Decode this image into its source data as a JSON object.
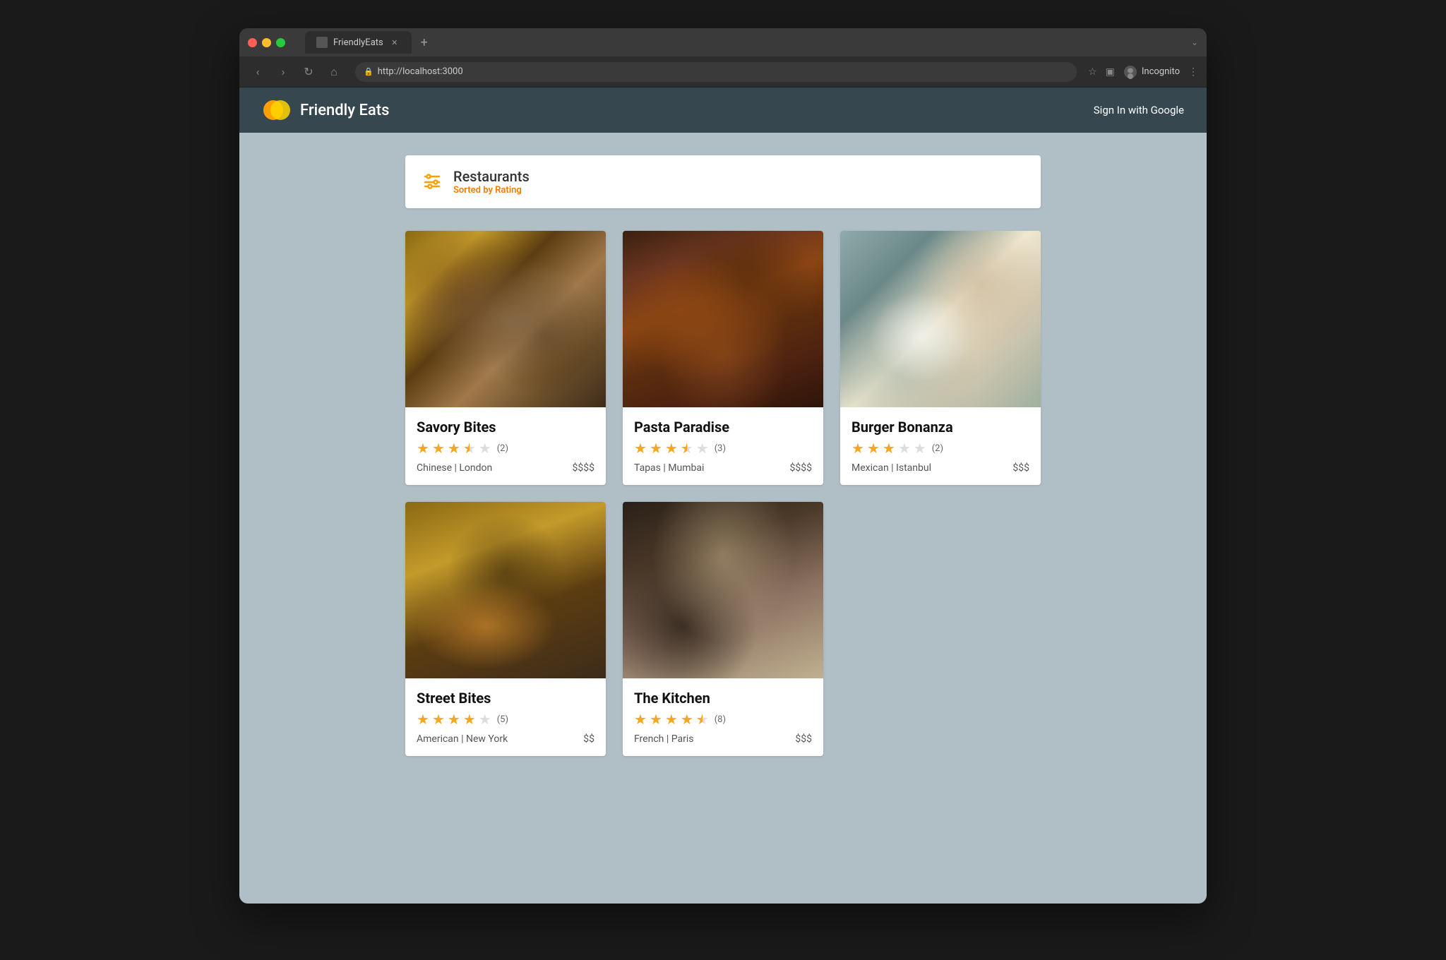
{
  "browser": {
    "traffic_lights": [
      "red",
      "yellow",
      "green"
    ],
    "tab_title": "FriendlyEats",
    "new_tab_label": "+",
    "address": "http://localhost:3000",
    "nav": {
      "back": "‹",
      "forward": "›",
      "reload": "↻",
      "home": "⌂"
    },
    "right_controls": {
      "star": "☆",
      "square": "▣",
      "incognito_label": "Incognito",
      "menu": "⋮",
      "dropdown": "⌄"
    }
  },
  "app": {
    "name": "Friendly Eats",
    "sign_in_label": "Sign In with Google",
    "header": {
      "title": "Restaurants",
      "subtitle": "Sorted by Rating"
    },
    "restaurants": [
      {
        "id": 1,
        "name": "Savory Bites",
        "stars": 3.5,
        "review_count": 2,
        "cuisine": "Chinese",
        "location": "London",
        "price": "$$$$",
        "image_type": "pasta"
      },
      {
        "id": 2,
        "name": "Pasta Paradise",
        "stars": 3.5,
        "review_count": 3,
        "cuisine": "Tapas",
        "location": "Mumbai",
        "price": "$$$$",
        "image_type": "meat"
      },
      {
        "id": 3,
        "name": "Burger Bonanza",
        "stars": 3,
        "review_count": 2,
        "cuisine": "Mexican",
        "location": "Istanbul",
        "price": "$$$",
        "image_type": "tableview"
      },
      {
        "id": 4,
        "name": "Street Bites",
        "stars": 4,
        "review_count": 5,
        "cuisine": "American",
        "location": "New York",
        "price": "$$",
        "image_type": "burger"
      },
      {
        "id": 5,
        "name": "The Kitchen",
        "stars": 4.5,
        "review_count": 8,
        "cuisine": "French",
        "location": "Paris",
        "price": "$$$",
        "image_type": "interior"
      }
    ]
  }
}
